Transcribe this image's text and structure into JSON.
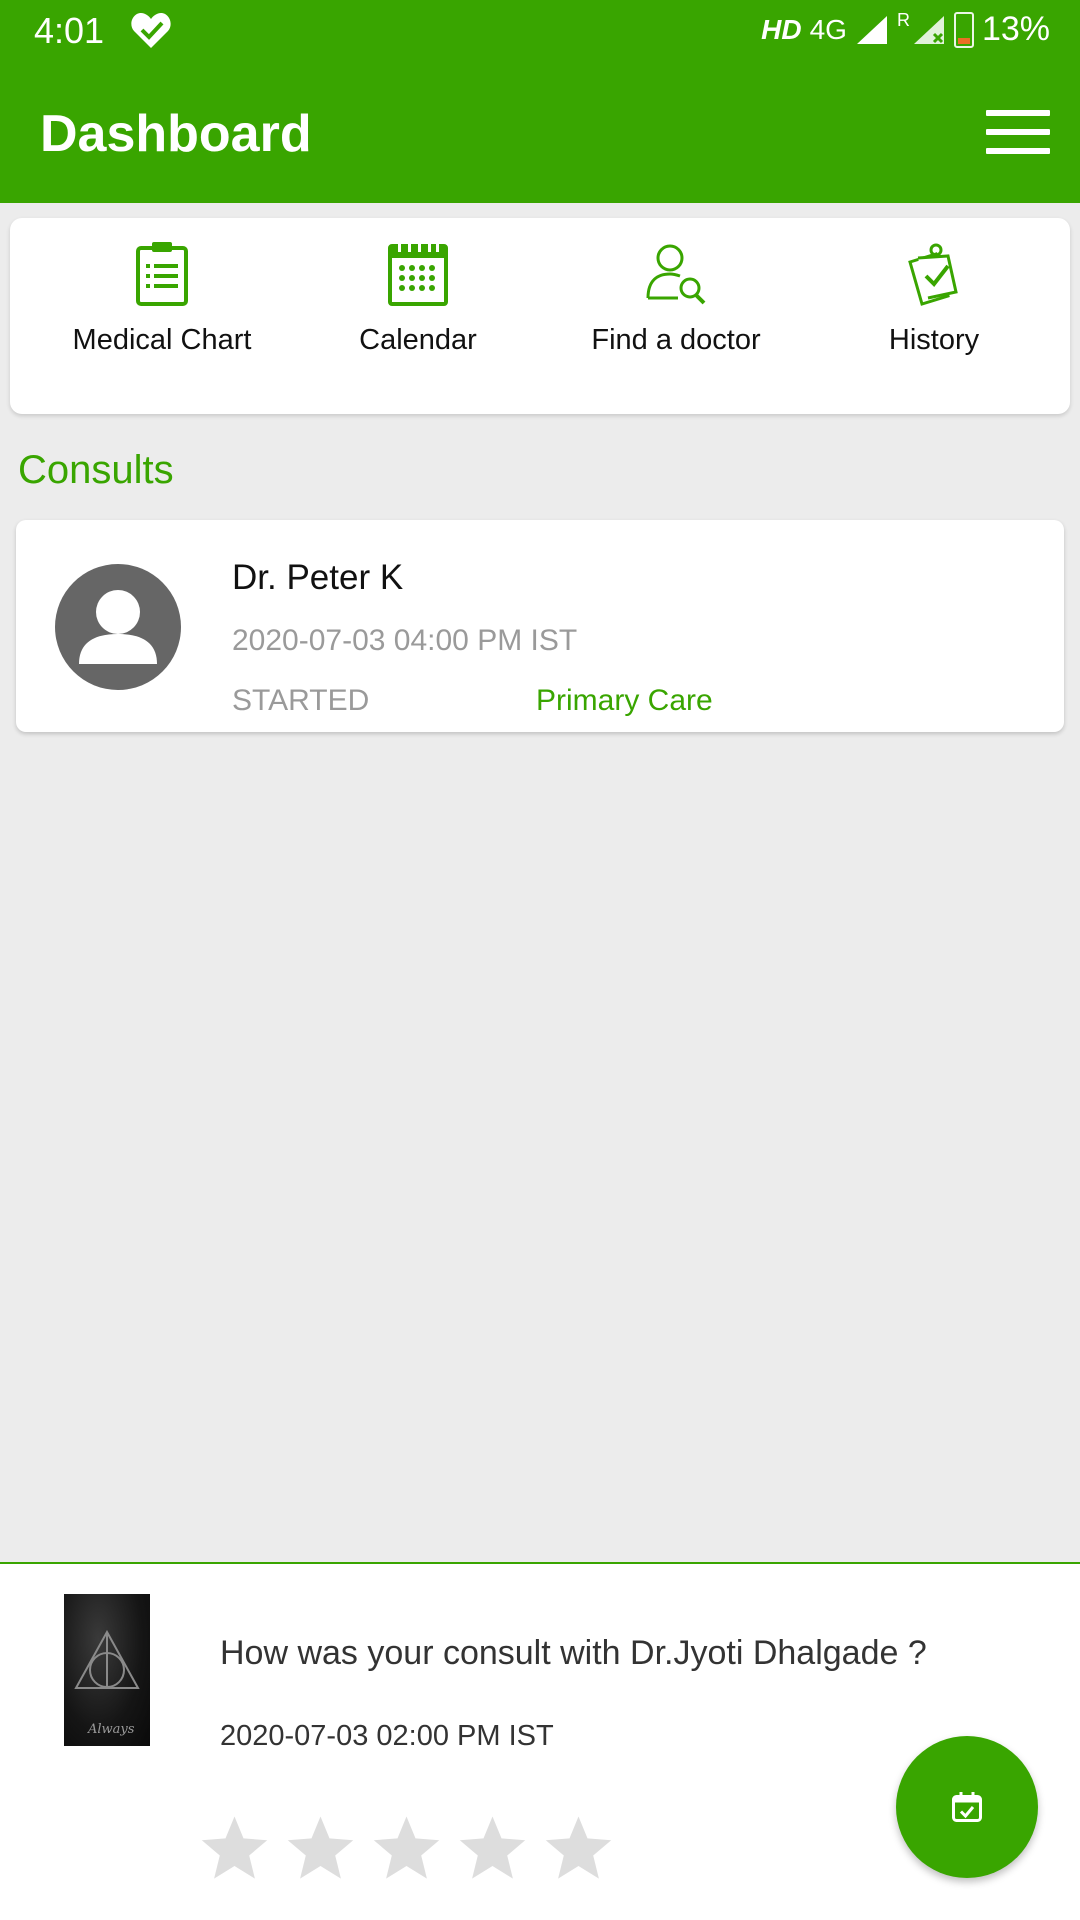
{
  "status_bar": {
    "time": "4:01",
    "hd": "HD",
    "network": "4G",
    "roaming": "R",
    "battery": "13%"
  },
  "app_bar": {
    "title": "Dashboard",
    "menu_icon": "hamburger-menu-icon"
  },
  "quick_actions": [
    {
      "label": "Medical Chart",
      "icon": "clipboard-icon"
    },
    {
      "label": "Calendar",
      "icon": "calendar-icon"
    },
    {
      "label": "Find a doctor",
      "icon": "doctor-search-icon"
    },
    {
      "label": "History",
      "icon": "history-check-icon"
    }
  ],
  "consults": {
    "title": "Consults",
    "items": [
      {
        "doctor": "Dr. Peter K",
        "datetime": "2020-07-03 04:00 PM IST",
        "status": "STARTED",
        "specialty": "Primary Care",
        "avatar_icon": "person-avatar-icon"
      }
    ]
  },
  "rating": {
    "question": "How was your consult with Dr.Jyoti Dhalgade ?",
    "datetime": "2020-07-03 02:00 PM IST",
    "thumbnail_text": "Always",
    "stars_total": 5,
    "stars_selected": 0
  },
  "fab": {
    "icon": "calendar-check-icon"
  },
  "colors": {
    "primary": "#39a500",
    "background": "#ececec",
    "muted_text": "#9a9a9a",
    "star_empty": "#dddddd"
  }
}
